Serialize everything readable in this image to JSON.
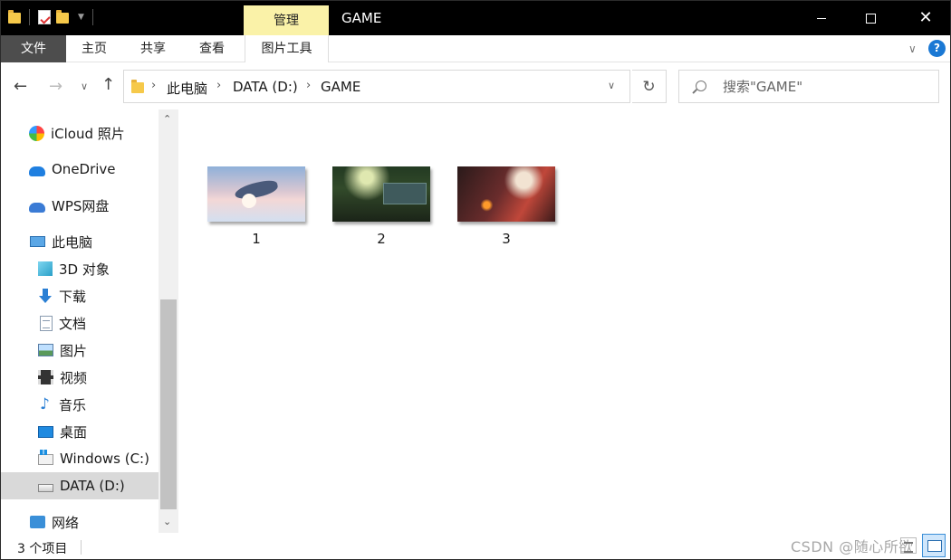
{
  "window": {
    "title": "GAME",
    "context_tab": "管理",
    "controls": {
      "minimize": "minimize-icon",
      "maximize": "maximize-icon",
      "close": "close-icon"
    }
  },
  "ribbon": {
    "tabs": [
      {
        "label": "文件",
        "active": true
      },
      {
        "label": "主页"
      },
      {
        "label": "共享"
      },
      {
        "label": "查看"
      },
      {
        "label": "图片工具"
      }
    ],
    "help": "?"
  },
  "address": {
    "crumbs": [
      "此电脑",
      "DATA (D:)",
      "GAME"
    ],
    "separator": "›"
  },
  "search": {
    "placeholder": "搜索\"GAME\""
  },
  "sidebar": {
    "items": [
      {
        "label": "iCloud 照片",
        "icon": "icloud-photos-icon"
      },
      {
        "label": "OneDrive",
        "icon": "onedrive-icon"
      },
      {
        "label": "WPS网盘",
        "icon": "wps-cloud-icon"
      },
      {
        "label": "此电脑",
        "icon": "this-pc-icon"
      },
      {
        "label": "3D 对象",
        "icon": "3d-objects-icon"
      },
      {
        "label": "下载",
        "icon": "downloads-icon"
      },
      {
        "label": "文档",
        "icon": "documents-icon"
      },
      {
        "label": "图片",
        "icon": "pictures-icon"
      },
      {
        "label": "视频",
        "icon": "videos-icon"
      },
      {
        "label": "音乐",
        "icon": "music-icon"
      },
      {
        "label": "桌面",
        "icon": "desktop-icon"
      },
      {
        "label": "Windows (C:)",
        "icon": "windows-drive-icon"
      },
      {
        "label": "DATA (D:)",
        "icon": "data-drive-icon",
        "selected": true
      },
      {
        "label": "网络",
        "icon": "network-icon"
      }
    ]
  },
  "files": [
    {
      "name": "1"
    },
    {
      "name": "2"
    },
    {
      "name": "3"
    }
  ],
  "status": {
    "count": "3 个项目",
    "watermark": "CSDN @随心所欲"
  },
  "colors": {
    "titlebar": "#000000",
    "context_tab_bg": "#faf2a8",
    "file_tab_bg": "#4d4d4d",
    "selection": "#d9d9d9",
    "accent": "#1a78d4"
  }
}
